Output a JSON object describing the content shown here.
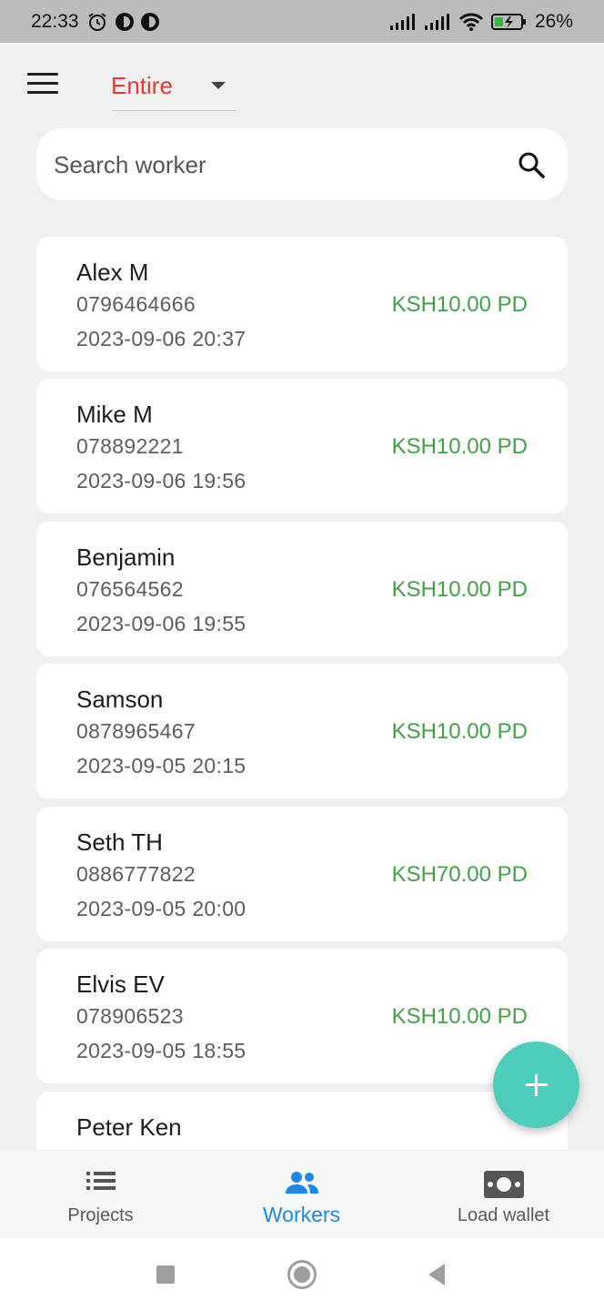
{
  "status_bar": {
    "time": "22:33",
    "battery": "26%"
  },
  "header": {
    "filter_value": "Entire"
  },
  "search": {
    "placeholder": "Search worker"
  },
  "workers": [
    {
      "name": "Alex M",
      "phone": "0796464666",
      "date": "2023-09-06 20:37",
      "amount": "KSH10.00 PD"
    },
    {
      "name": "Mike M",
      "phone": "078892221",
      "date": "2023-09-06 19:56",
      "amount": "KSH10.00 PD"
    },
    {
      "name": "Benjamin",
      "phone": "076564562",
      "date": "2023-09-06 19:55",
      "amount": "KSH10.00 PD"
    },
    {
      "name": "Samson",
      "phone": "0878965467",
      "date": "2023-09-05 20:15",
      "amount": "KSH10.00 PD"
    },
    {
      "name": "Seth TH",
      "phone": "0886777822",
      "date": "2023-09-05 20:00",
      "amount": "KSH70.00 PD"
    },
    {
      "name": "Elvis EV",
      "phone": "078906523",
      "date": "2023-09-05 18:55",
      "amount": "KSH10.00 PD"
    },
    {
      "name": "Peter Ken",
      "phone": "",
      "date": "",
      "amount": ""
    }
  ],
  "bottom_nav": [
    {
      "label": "Projects",
      "icon": "list-icon"
    },
    {
      "label": "Workers",
      "icon": "people-icon",
      "active": true
    },
    {
      "label": "Load wallet",
      "icon": "money-icon"
    }
  ],
  "colors": {
    "accent": "#1e88e5",
    "filter": "#e53935",
    "amount": "#43a047",
    "fab": "#4ecdbd"
  }
}
